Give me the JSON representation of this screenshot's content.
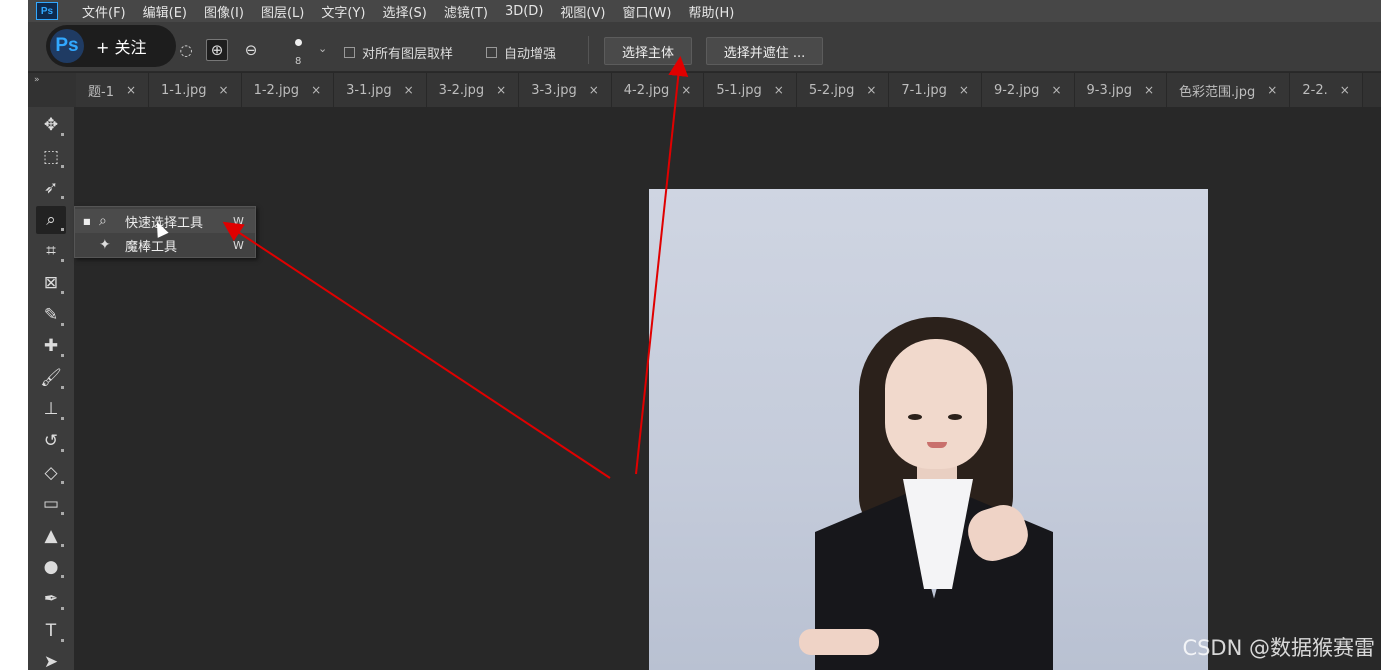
{
  "menubar": {
    "ps_icon": "Ps",
    "items": [
      "文件(F)",
      "编辑(E)",
      "图像(I)",
      "图层(L)",
      "文字(Y)",
      "选择(S)",
      "滤镜(T)",
      "3D(D)",
      "视图(V)",
      "窗口(W)",
      "帮助(H)"
    ]
  },
  "follow_badge": {
    "logo": "Ps",
    "label": "+ 关注"
  },
  "options": {
    "brush_size": "8",
    "brush_chevron": "⌄",
    "sample_all_layers": {
      "label": "对所有图层取样",
      "checked": false
    },
    "auto_enhance": {
      "label": "自动增强",
      "checked": false
    },
    "select_subject": "选择主体",
    "select_and_mask": "选择并遮住 ..."
  },
  "tabbar": {
    "collapse_glyph": "»",
    "tabs": [
      "题-1",
      "1-1.jpg",
      "1-2.jpg",
      "3-1.jpg",
      "3-2.jpg",
      "3-3.jpg",
      "4-2.jpg",
      "5-1.jpg",
      "5-2.jpg",
      "7-1.jpg",
      "9-2.jpg",
      "9-3.jpg",
      "色彩范围.jpg",
      "2-2."
    ],
    "close_glyph": "×"
  },
  "toolbox": [
    {
      "name": "move-tool",
      "glyph": "✥"
    },
    {
      "name": "marquee-tool",
      "glyph": "⬚"
    },
    {
      "name": "lasso-tool",
      "glyph": "➶"
    },
    {
      "name": "quick-selection-tool",
      "glyph": "⌕"
    },
    {
      "name": "crop-tool",
      "glyph": "⌗"
    },
    {
      "name": "frame-tool",
      "glyph": "⊠"
    },
    {
      "name": "eyedropper-tool",
      "glyph": "✎"
    },
    {
      "name": "healing-brush-tool",
      "glyph": "✚"
    },
    {
      "name": "brush-tool",
      "glyph": "🖌"
    },
    {
      "name": "clone-stamp-tool",
      "glyph": "⊥"
    },
    {
      "name": "history-brush-tool",
      "glyph": "↺"
    },
    {
      "name": "eraser-tool",
      "glyph": "◇"
    },
    {
      "name": "gradient-tool",
      "glyph": "▭"
    },
    {
      "name": "blur-tool",
      "glyph": "▲"
    },
    {
      "name": "dodge-tool",
      "glyph": "●"
    },
    {
      "name": "pen-tool",
      "glyph": "✒"
    },
    {
      "name": "type-tool",
      "glyph": "T"
    },
    {
      "name": "path-selection-tool",
      "glyph": "➤"
    }
  ],
  "flyout": {
    "items": [
      {
        "label": "快速选择工具",
        "shortcut": "W",
        "selected": true,
        "bullet": "■",
        "icon": "⌕"
      },
      {
        "label": "魔棒工具",
        "shortcut": "W",
        "selected": false,
        "bullet": "",
        "icon": "✦"
      }
    ]
  },
  "colors": {
    "arrow": "#e00000",
    "app_bg": "#282828",
    "panel": "#3c3c3c"
  },
  "watermark": "CSDN @数据猴赛雷"
}
